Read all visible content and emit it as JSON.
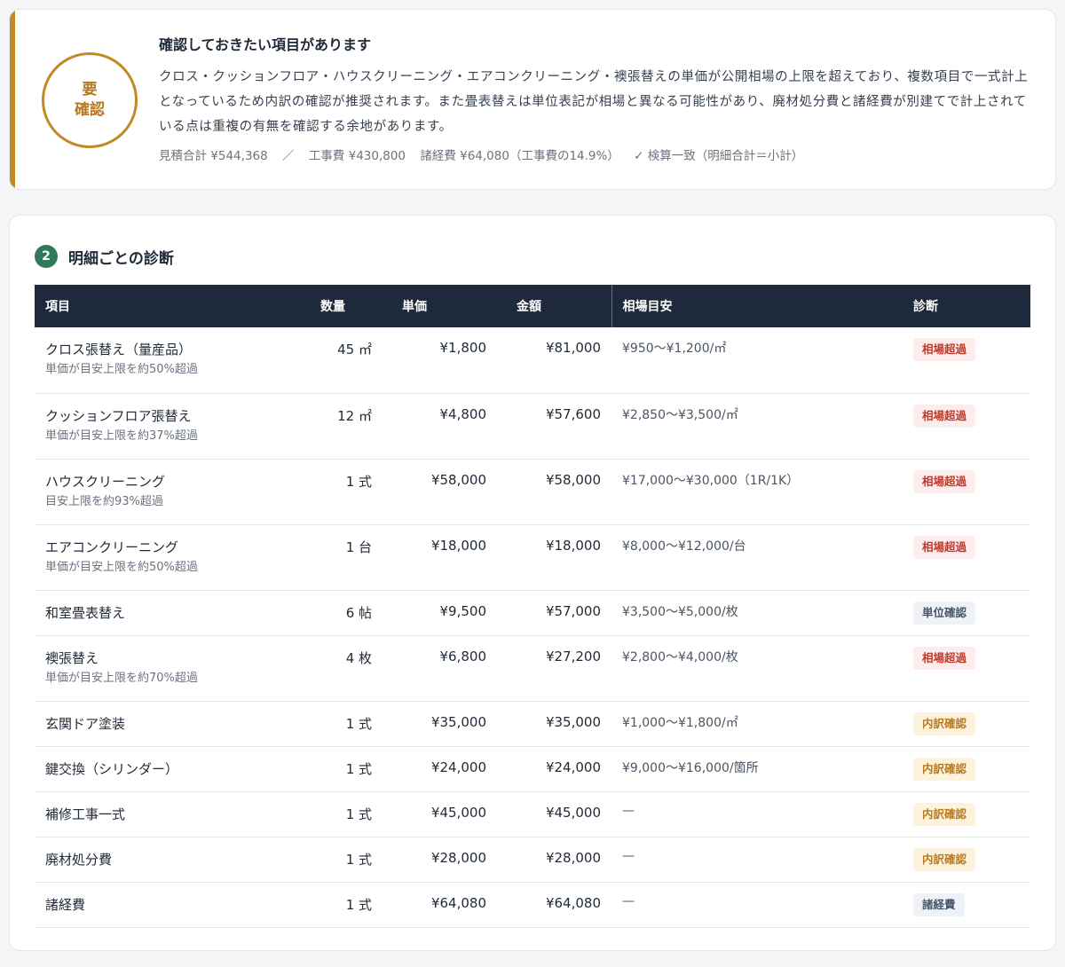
{
  "summary": {
    "badge_line1": "要",
    "badge_line2": "確認",
    "title": "確認しておきたい項目があります",
    "body": "クロス・クッションフロア・ハウスクリーニング・エアコンクリーニング・襖張替えの単価が公開相場の上限を超えており、複数項目で一式計上となっているため内訳の確認が推奨されます。また畳表替えは単位表記が相場と異なる可能性があり、廃材処分費と諸経費が別建てで計上されている点は重複の有無を確認する余地があります。",
    "meta": {
      "estimate_total": "見積合計 ¥544,368",
      "divider": "／",
      "construction": "工事費 ¥430,800",
      "expenses": "諸経費 ¥64,080（工事費の14.9%）",
      "check": "✓ 検算一致（明細合計＝小計）"
    }
  },
  "detail": {
    "step": "2",
    "title": "明細ごとの診断",
    "headers": {
      "item": "項目",
      "qty": "数量",
      "unit_price": "単価",
      "amount": "金額",
      "market": "相場目安",
      "diagnosis": "診断"
    },
    "rows": [
      {
        "name": "クロス張替え（量産品）",
        "note": "単価が目安上限を約50%超過",
        "qty": "45 ㎡",
        "unit_price": "¥1,800",
        "amount": "¥81,000",
        "market": "¥950〜¥1,200/㎡",
        "diag": "相場超過",
        "diag_type": "over"
      },
      {
        "name": "クッションフロア張替え",
        "note": "単価が目安上限を約37%超過",
        "qty": "12 ㎡",
        "unit_price": "¥4,800",
        "amount": "¥57,600",
        "market": "¥2,850〜¥3,500/㎡",
        "diag": "相場超過",
        "diag_type": "over"
      },
      {
        "name": "ハウスクリーニング",
        "note": "目安上限を約93%超過",
        "qty": "1 式",
        "unit_price": "¥58,000",
        "amount": "¥58,000",
        "market": "¥17,000〜¥30,000（1R/1K）",
        "diag": "相場超過",
        "diag_type": "over"
      },
      {
        "name": "エアコンクリーニング",
        "note": "単価が目安上限を約50%超過",
        "qty": "1 台",
        "unit_price": "¥18,000",
        "amount": "¥18,000",
        "market": "¥8,000〜¥12,000/台",
        "diag": "相場超過",
        "diag_type": "over"
      },
      {
        "name": "和室畳表替え",
        "note": "",
        "qty": "6 帖",
        "unit_price": "¥9,500",
        "amount": "¥57,000",
        "market": "¥3,500〜¥5,000/枚",
        "diag": "単位確認",
        "diag_type": "unit"
      },
      {
        "name": "襖張替え",
        "note": "単価が目安上限を約70%超過",
        "qty": "4 枚",
        "unit_price": "¥6,800",
        "amount": "¥27,200",
        "market": "¥2,800〜¥4,000/枚",
        "diag": "相場超過",
        "diag_type": "over"
      },
      {
        "name": "玄関ドア塗装",
        "note": "",
        "qty": "1 式",
        "unit_price": "¥35,000",
        "amount": "¥35,000",
        "market": "¥1,000〜¥1,800/㎡",
        "diag": "内訳確認",
        "diag_type": "breakdown"
      },
      {
        "name": "鍵交換（シリンダー）",
        "note": "",
        "qty": "1 式",
        "unit_price": "¥24,000",
        "amount": "¥24,000",
        "market": "¥9,000〜¥16,000/箇所",
        "diag": "内訳確認",
        "diag_type": "breakdown"
      },
      {
        "name": "補修工事一式",
        "note": "",
        "qty": "1 式",
        "unit_price": "¥45,000",
        "amount": "¥45,000",
        "market": "—",
        "diag": "内訳確認",
        "diag_type": "breakdown"
      },
      {
        "name": "廃材処分費",
        "note": "",
        "qty": "1 式",
        "unit_price": "¥28,000",
        "amount": "¥28,000",
        "market": "—",
        "diag": "内訳確認",
        "diag_type": "breakdown"
      },
      {
        "name": "諸経費",
        "note": "",
        "qty": "1 式",
        "unit_price": "¥64,080",
        "amount": "¥64,080",
        "market": "—",
        "diag": "諸経費",
        "diag_type": "expense"
      }
    ]
  }
}
